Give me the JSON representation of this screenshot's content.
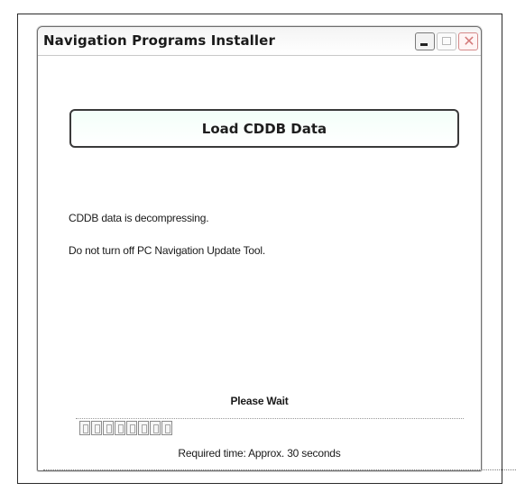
{
  "window": {
    "title": "Navigation Programs Installer",
    "controls": {
      "minimize_icon": "minimize-icon",
      "maximize_icon": "maximize-icon",
      "close_icon": "close-icon"
    }
  },
  "main": {
    "load_button_label": "Load CDDB Data",
    "messages": [
      "CDDB data is decompressing.",
      "Do not turn off PC Navigation Update Tool."
    ],
    "wait_text": "Please Wait",
    "required_time_text": "Required time: Approx. 30 seconds",
    "progress_segments": 8
  },
  "colors": {
    "button_bg": "#f3fff9",
    "border": "#3a3a3a"
  }
}
